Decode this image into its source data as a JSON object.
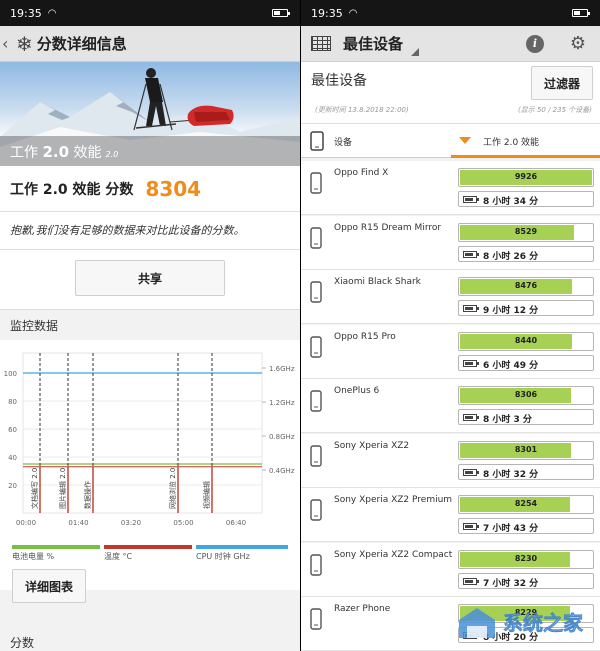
{
  "status_bar": {
    "time": "19:35"
  },
  "left": {
    "title": "分数详细信息",
    "hero": {
      "label_pre": "工作 ",
      "label_bold": "2.0",
      "label_post": " 效能",
      "version": "2.0"
    },
    "score_label": "工作 2.0 效能 分数",
    "score_value": "8304",
    "sorry_text": "抱歉,我们没有足够的数据来对比此设备的分数。",
    "share_label": "共享",
    "monitor_title": "监控数据",
    "detail_label": "详细图表",
    "score_section": "分数",
    "chart_data": {
      "type": "line",
      "x_ticks": [
        "00:00",
        "01:40",
        "03:20",
        "05:00",
        "06:40"
      ],
      "y_left_ticks": [
        "20",
        "40",
        "60",
        "80",
        "100"
      ],
      "y_right_ticks": [
        "0.4GHz",
        "0.8GHz",
        "1.2GHz",
        "1.6GHz"
      ],
      "markers": [
        "文档编写 2.0",
        "图片编辑 2.0",
        "数据操作",
        "网络浏览 2.0",
        "视频编辑"
      ],
      "series": [
        {
          "name": "电池电量 %",
          "color": "#78c043",
          "level": 100
        },
        {
          "name": "温度 °C",
          "color": "#c0392b",
          "level": 35
        },
        {
          "name": "CPU 时钟 GHz",
          "color": "#3ea7df",
          "level": 100
        }
      ]
    }
  },
  "right": {
    "title": "最佳设备",
    "list_title": "最佳设备",
    "filter_label": "过滤器",
    "updated": "(更新时间 13.8.2018 22:00)",
    "shown": "(显示 50 / 235 个设备)",
    "col_device": "设备",
    "col_score": "工作 2.0 效能",
    "devices": [
      {
        "name": "Oppo Find X",
        "score": "9926",
        "battery": "8 小时 34 分",
        "pct": 1.0
      },
      {
        "name": "Oppo R15 Dream Mirror",
        "score": "8529",
        "battery": "8 小时 26 分",
        "pct": 0.86
      },
      {
        "name": "Xiaomi Black Shark",
        "score": "8476",
        "battery": "9 小时 12 分",
        "pct": 0.85
      },
      {
        "name": "Oppo R15 Pro",
        "score": "8440",
        "battery": "6 小时 49 分",
        "pct": 0.85
      },
      {
        "name": "OnePlus 6",
        "score": "8306",
        "battery": "8 小时 3 分",
        "pct": 0.84
      },
      {
        "name": "Sony Xperia XZ2",
        "score": "8301",
        "battery": "8 小时 32 分",
        "pct": 0.84
      },
      {
        "name": "Sony Xperia XZ2 Premium",
        "score": "8254",
        "battery": "7 小时 43 分",
        "pct": 0.83
      },
      {
        "name": "Sony Xperia XZ2 Compact",
        "score": "8230",
        "battery": "7 小时 32 分",
        "pct": 0.83
      },
      {
        "name": "Razer Phone",
        "score": "8229",
        "battery": "8 小时 20 分",
        "pct": 0.83
      }
    ]
  },
  "watermark": {
    "text": "系统之家"
  },
  "colors": {
    "accent": "#f08c1c",
    "score_bar": "#a6d155"
  }
}
